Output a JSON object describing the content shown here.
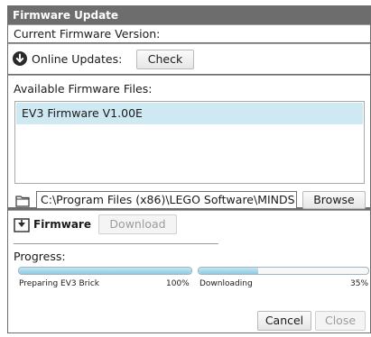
{
  "window": {
    "title": "Firmware Update"
  },
  "current": {
    "label": "Current Firmware Version:"
  },
  "online": {
    "label": "Online Updates:",
    "check_label": "Check",
    "icon": "download-circle-icon"
  },
  "available": {
    "label": "Available Firmware Files:",
    "files": [
      "EV3 Firmware V1.00E"
    ]
  },
  "path": {
    "value": "C:\\Program Files (x86)\\LEGO Software\\MINDS",
    "browse_label": "Browse"
  },
  "firmware_section": {
    "label": "Firmware",
    "download_label": "Download"
  },
  "progress": {
    "label": "Progress:",
    "left": {
      "text": "Preparing EV3 Brick",
      "percent_text": "100%",
      "fraction": 1.0
    },
    "right": {
      "text": "Downloading",
      "percent_text": "35%",
      "fraction": 0.35
    }
  },
  "footer": {
    "cancel_label": "Cancel",
    "close_label": "Close"
  }
}
